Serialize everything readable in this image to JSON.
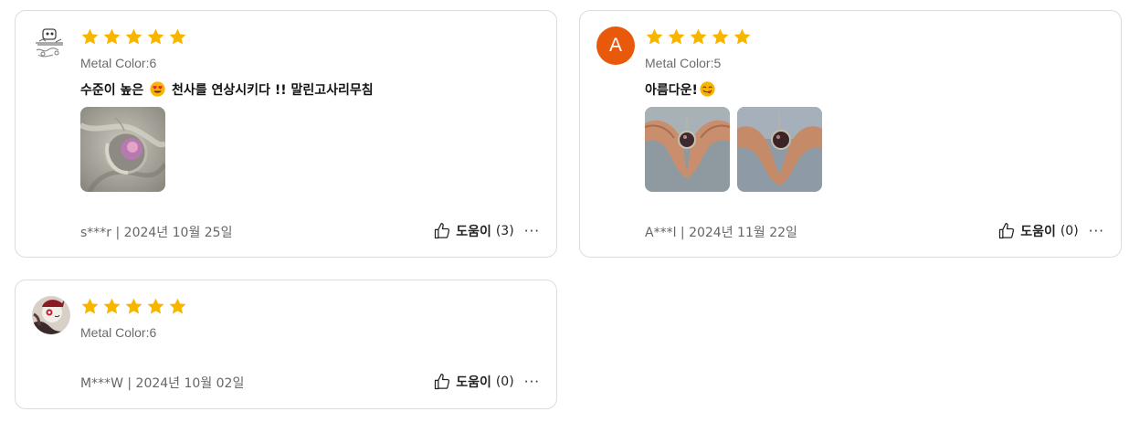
{
  "reviews": [
    {
      "rating": 5,
      "metal_color": "Metal Color:6",
      "content_before_emoji": "수준이 높은 ",
      "content_after_emoji": " 천사를 연상시키다 !! 말린고사리무침",
      "content_emoji": "heart-eyes-emoji",
      "photos": 1,
      "author_date": "s***r | 2024년 10월 25일",
      "helpful_label": "도움이",
      "helpful_count": "(3)",
      "more": "···"
    },
    {
      "rating": 5,
      "avatar_letter": "A",
      "metal_color": "Metal Color:5",
      "content_before_emoji": "아름다운!",
      "content_after_emoji": "",
      "content_emoji": "yum-emoji",
      "photos": 2,
      "author_date": "A***l | 2024년 11월 22일",
      "helpful_label": "도움이",
      "helpful_count": "(0)",
      "more": "···"
    },
    {
      "rating": 5,
      "metal_color": "Metal Color:6",
      "author_date": "M***W | 2024년 10월 02일",
      "helpful_label": "도움이",
      "helpful_count": "(0)",
      "more": "···"
    }
  ],
  "colors": {
    "star": "#f7b500",
    "avatar_letter_bg": "#e8590c",
    "border": "#dcdcdc"
  }
}
